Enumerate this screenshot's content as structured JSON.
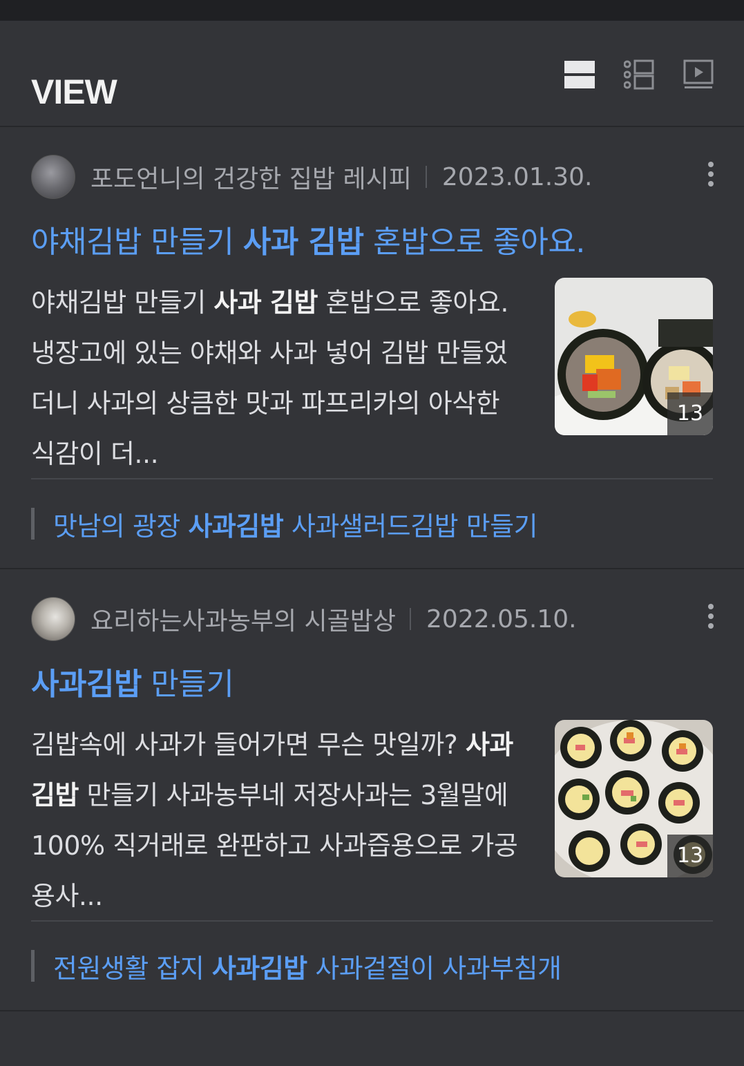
{
  "header": {
    "title": "VIEW",
    "layout_icons": [
      "card-view-icon",
      "list-view-icon",
      "video-view-icon"
    ]
  },
  "posts": [
    {
      "blog_name": "포도언니의 건강한 집밥 레시피",
      "date": "2023.01.30.",
      "title_pre": "야채김밥 만들기 ",
      "title_bold": "사과 김밥",
      "title_post": " 혼밥으로 좋아요.",
      "snippet_pre": "야채김밥 만들기 ",
      "snippet_bold": "사과 김밥",
      "snippet_post": " 혼밥으로 좋아요. 냉장고에 있는 야채와 사과 넣어 김밥 만들었더니 사과의 상큼한 맛과 파프리카의 아삭한 식감이 더...",
      "thumb_count": "13",
      "related_pre": "맛남의 광장 ",
      "related_bold": "사과김밥",
      "related_post": " 사과샐러드김밥 만들기"
    },
    {
      "blog_name": "요리하는사과농부의 시골밥상",
      "date": "2022.05.10.",
      "title_pre": "",
      "title_bold": "사과김밥",
      "title_post": " 만들기",
      "snippet_pre": "김밥속에 사과가 들어가면 무슨 맛일까? ",
      "snippet_bold": "사과김밥",
      "snippet_post": " 만들기 사과농부네 저장사과는 3월말에 100% 직거래로 완판하고 사과즙용으로 가공용사...",
      "thumb_count": "13",
      "related_pre": "전원생활 잡지 ",
      "related_bold": "사과김밥",
      "related_post": " 사과겉절이 사과부침개"
    }
  ]
}
